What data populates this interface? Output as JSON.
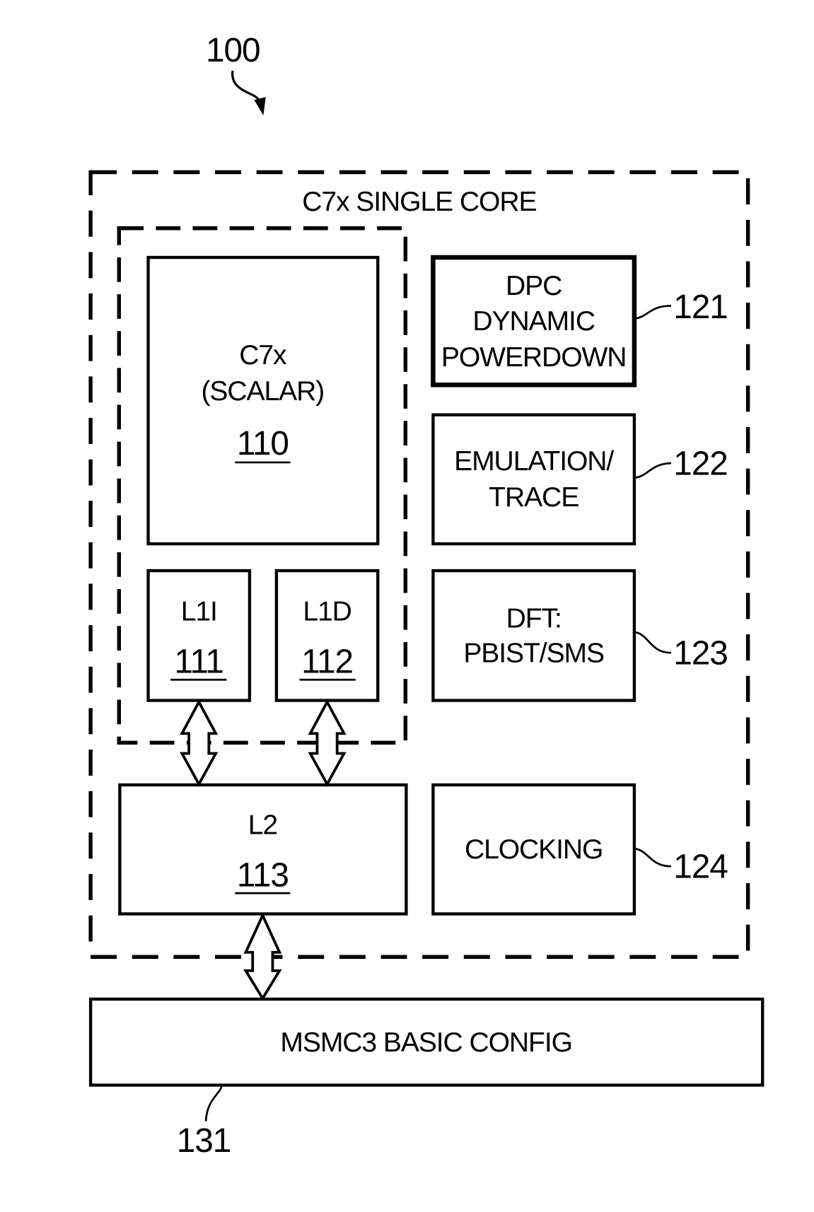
{
  "figure": {
    "ref": "100"
  },
  "core": {
    "title": "C7x SINGLE CORE"
  },
  "blocks": {
    "scalar": {
      "lines": [
        "C7x",
        "(SCALAR)"
      ],
      "ref": "110"
    },
    "l1i": {
      "label": "L1I",
      "ref": "111"
    },
    "l1d": {
      "label": "L1D",
      "ref": "112"
    },
    "l2": {
      "label": "L2",
      "ref": "113"
    },
    "dpc": {
      "lines": [
        "DPC",
        "DYNAMIC",
        "POWERDOWN"
      ],
      "ref": "121"
    },
    "emulation": {
      "lines": [
        "EMULATION/",
        "TRACE"
      ],
      "ref": "122"
    },
    "dft": {
      "lines": [
        "DFT:",
        "PBIST/SMS"
      ],
      "ref": "123"
    },
    "clocking": {
      "label": "CLOCKING",
      "ref": "124"
    },
    "msmc": {
      "label": "MSMC3 BASIC CONFIG",
      "ref": "131"
    }
  }
}
